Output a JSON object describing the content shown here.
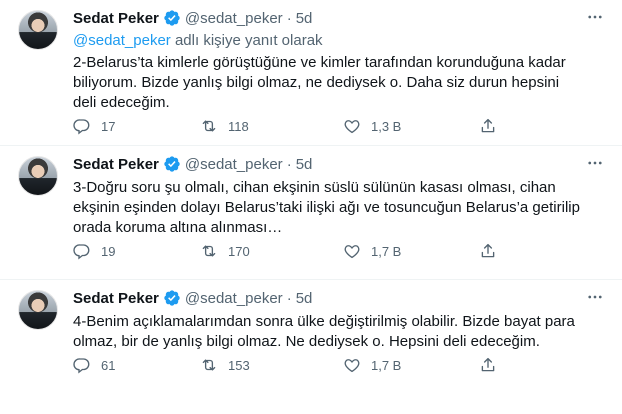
{
  "tweets": [
    {
      "name": "Sedat Peker",
      "handle": "@sedat_peker",
      "sep": "·",
      "time": "5d",
      "reply_mention": "@sedat_peker",
      "reply_suffix": " adlı kişiye yanıt olarak",
      "text": "2-Belarus’ta kimlerle görüştüğüne ve kimler tarafından korunduğuna kadar\nbiliyorum. Bizde yanlış bilgi olmaz, ne dediysek o. Daha siz durun hepsini\ndeli edeceğim.",
      "replies": "17",
      "retweets": "118",
      "likes": "1,3 B"
    },
    {
      "name": "Sedat Peker",
      "handle": "@sedat_peker",
      "sep": "·",
      "time": "5d",
      "text": "3-Doğru soru şu olmalı, cihan ekşinin süslü sülünün kasası olması, cihan\nekşinin eşinden dolayı Belarus’taki ilişki ağı ve tosuncuğun Belarus’a getirilip\norada koruma altına alınması…",
      "replies": "19",
      "retweets": "170",
      "likes": "1,7 B"
    },
    {
      "name": "Sedat Peker",
      "handle": "@sedat_peker",
      "sep": "·",
      "time": "5d",
      "text": "4-Benim açıklamalarımdan sonra ülke değiştirilmiş olabilir. Bizde bayat para\nolmaz, bir de yanlış bilgi olmaz. Ne dediysek o. Hepsini deli edeceğim.",
      "replies": "61",
      "retweets": "153",
      "likes": "1,7 B"
    }
  ],
  "colors": {
    "accent": "#1d9bf0",
    "muted": "#536471",
    "text": "#0f1419"
  },
  "icons": [
    "verified-badge-icon",
    "more-icon",
    "reply-icon",
    "retweet-icon",
    "like-icon",
    "share-icon"
  ]
}
